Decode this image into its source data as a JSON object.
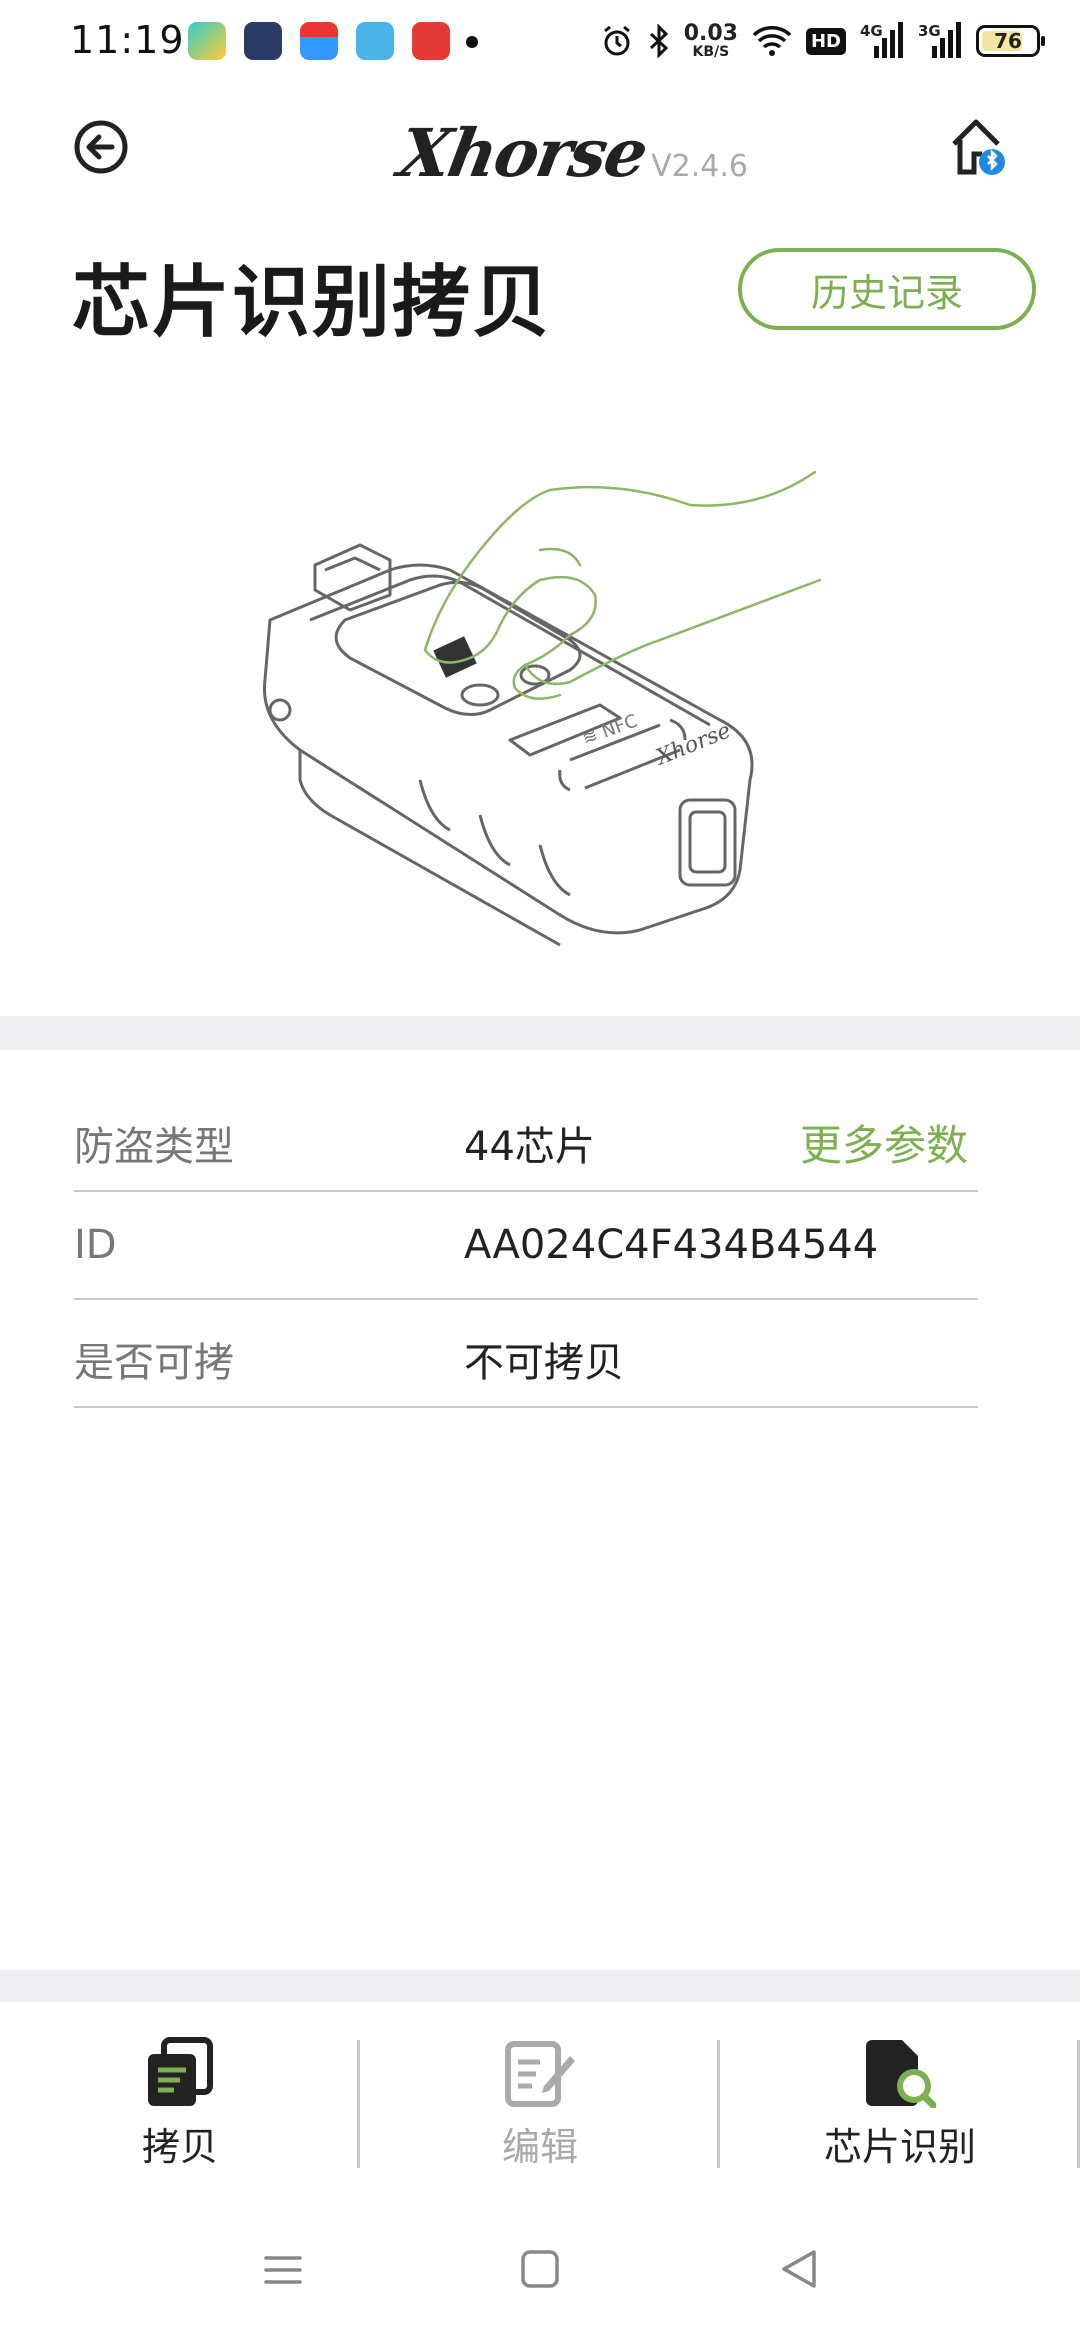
{
  "status_bar": {
    "time": "11:19",
    "net_speed_value": "0.03",
    "net_speed_unit": "KB/S",
    "hd_label": "HD",
    "net1_label": "4G",
    "net2_label": "3G",
    "battery_level": "76",
    "battery_fraction": 0.76
  },
  "header": {
    "brand": "Xhorse",
    "version": "V2.4.6"
  },
  "page": {
    "title": "芯片识别拷贝",
    "history_button": "历史记录"
  },
  "info_rows": [
    {
      "label": "防盗类型",
      "value": "44芯片",
      "link": "更多参数"
    },
    {
      "label": "ID",
      "value": "AA024C4F434B4544"
    },
    {
      "label": "是否可拷",
      "value": "不可拷贝"
    }
  ],
  "tabs": [
    {
      "label": "拷贝",
      "icon": "copy-icon",
      "active": false
    },
    {
      "label": "编辑",
      "icon": "edit-icon",
      "active": false
    },
    {
      "label": "芯片识别",
      "icon": "chip-search-icon",
      "active": true
    }
  ],
  "colors": {
    "accent": "#7cb051",
    "separator_band": "#eceff1",
    "disabled": "#aaaaaa"
  }
}
